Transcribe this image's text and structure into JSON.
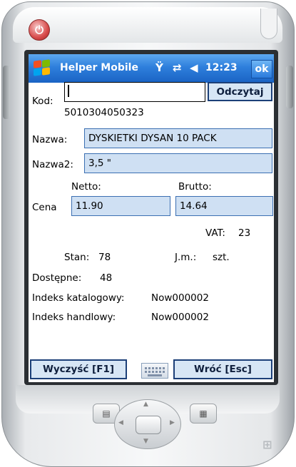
{
  "titlebar": {
    "app_title": "Helper Mobile",
    "time": "12:23",
    "ok_label": "ok",
    "icons": [
      "windows-start-icon",
      "antenna-icon",
      "sync-arrows-icon",
      "speaker-icon"
    ]
  },
  "form": {
    "kod_label": "Kod:",
    "kod_value": "",
    "read_button": "Odczytaj",
    "barcode": "5010304050323",
    "nazwa_label": "Nazwa:",
    "nazwa_value": "DYSKIETKI DYSAN 10 PACK",
    "nazwa2_label": "Nazwa2:",
    "nazwa2_value": "3,5 \"",
    "netto_label": "Netto:",
    "brutto_label": "Brutto:",
    "cena_label": "Cena",
    "netto_value": "11.90",
    "brutto_value": "14.64",
    "vat_label": "VAT:",
    "vat_value": "23",
    "stan_label": "Stan:",
    "stan_value": "78",
    "jm_label": "J.m.:",
    "jm_value": "szt.",
    "dostepne_label": "Dostępne:",
    "dostepne_value": "48",
    "indeks_kat_label": "Indeks katalogowy:",
    "indeks_kat_value": "Now000002",
    "indeks_handl_label": "Indeks handlowy:",
    "indeks_handl_value": "Now000002"
  },
  "bottom": {
    "clear_button": "Wyczyść [F1]",
    "back_button": "Wróć [Esc]"
  },
  "colors": {
    "titlebar": "#2e7fdc",
    "field_bg": "#cfe0f3",
    "field_border": "#3b6fb2",
    "button_border": "#1c3f78"
  }
}
